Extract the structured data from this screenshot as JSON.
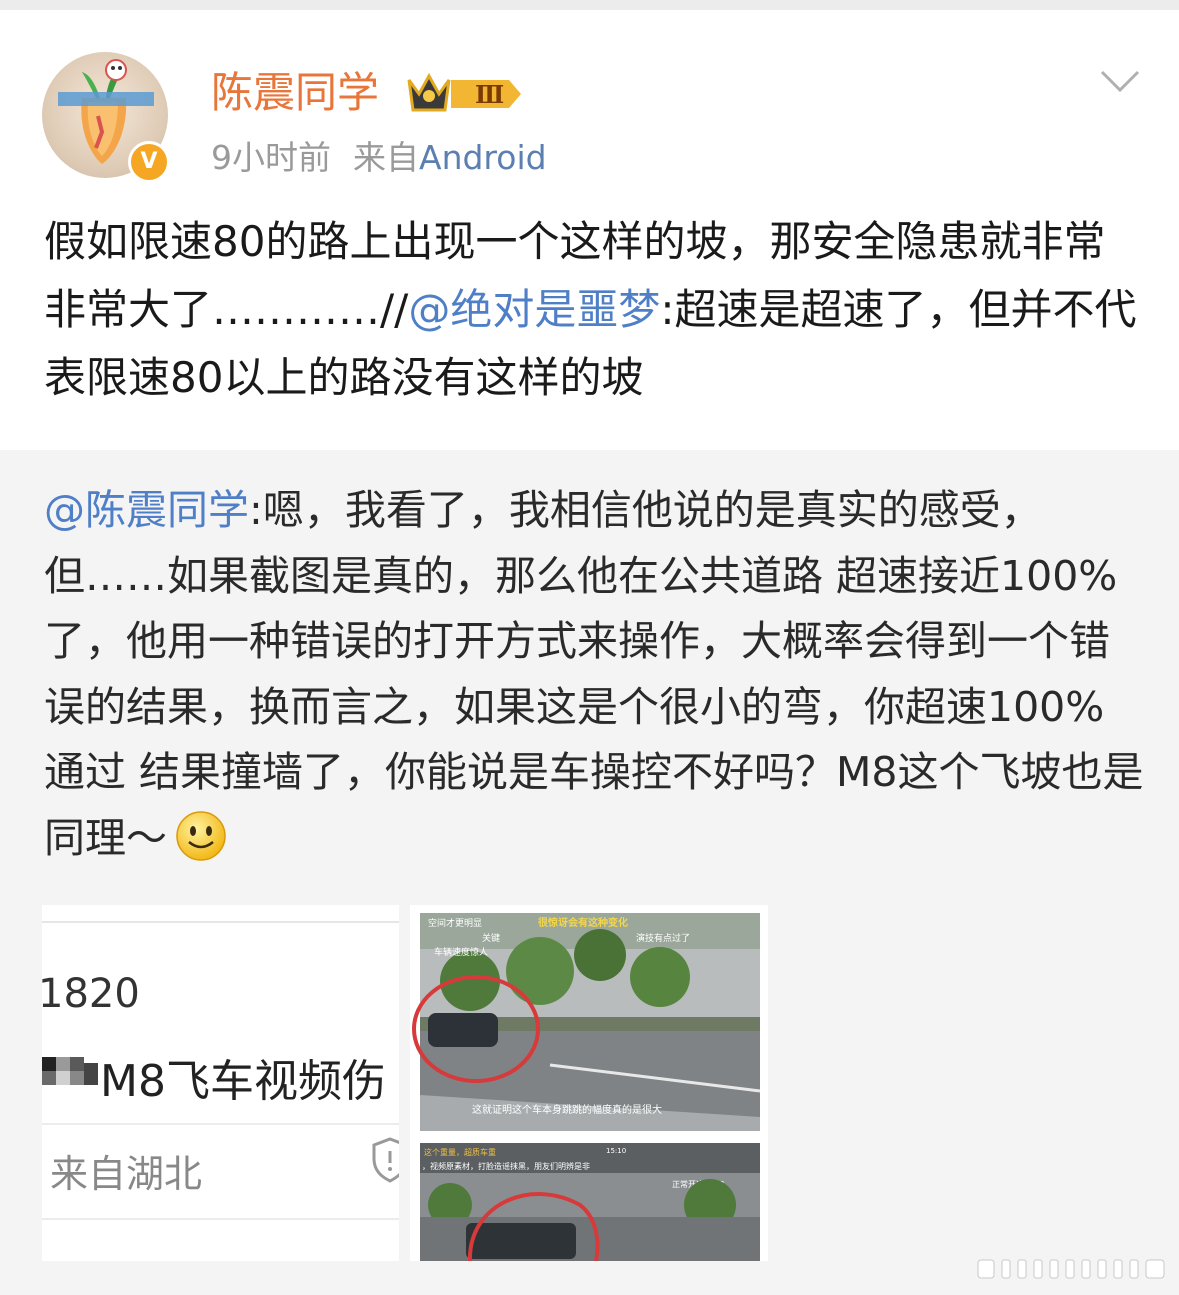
{
  "post": {
    "username": "陈震同学",
    "level_badge": "Ⅲ",
    "verified_badge": "V",
    "time": "9小时前",
    "source_prefix": "来自",
    "source": "Android",
    "text_main": "假如限速80的路上出现一个这样的坡，那安全隐患就非常非常大了…………//",
    "mention": "@绝对是噩梦",
    "text_rest": ":超速是超速了，但并不代表限速80以上的路没有这样的坡",
    "icons": {
      "menu": "chevron-down-icon",
      "badge": "crown-icon"
    }
  },
  "retweet": {
    "mention": "@陈震同学",
    "text": ":嗯，我看了，我相信他说的是真实的感受，但……如果截图是真的，那么他在公共道路 超速接近100%了，他用一种错误的打开方式来操作，大概率会得到一个错误的结果，换而言之，如果这是个很小的弯，你超速100%通过 结果撞墙了，你能说是车操控不好吗？M8这个飞坡也是同理～",
    "emoji": "smile-emoji-icon",
    "images": [
      {
        "number": "1820",
        "title": "M8飞车视频伤",
        "location": "来自湖北"
      },
      {
        "top_caption_left": "空间才更明显",
        "top_caption_center": "很惊讶会有这种变化",
        "caption_mid1": "关键",
        "caption_mid2": "车辆速度惊人",
        "caption_right": "演技有点过了",
        "subtitle": "这就证明这个车本身跳跳的幅度真的是很大",
        "bottom_caption_top": "这个重量，超质车重",
        "bottom_caption": "，视频原素材，打脸造谣抹黑，朋友们明辨是非",
        "bottom_caption_right": "正常开这么快?",
        "time": "15:10"
      }
    ]
  },
  "colors": {
    "username": "#e8763a",
    "mention": "#4f7fc7",
    "source": "#5b7fb0",
    "meta": "#9a9a9a",
    "verified": "#f5a623"
  }
}
